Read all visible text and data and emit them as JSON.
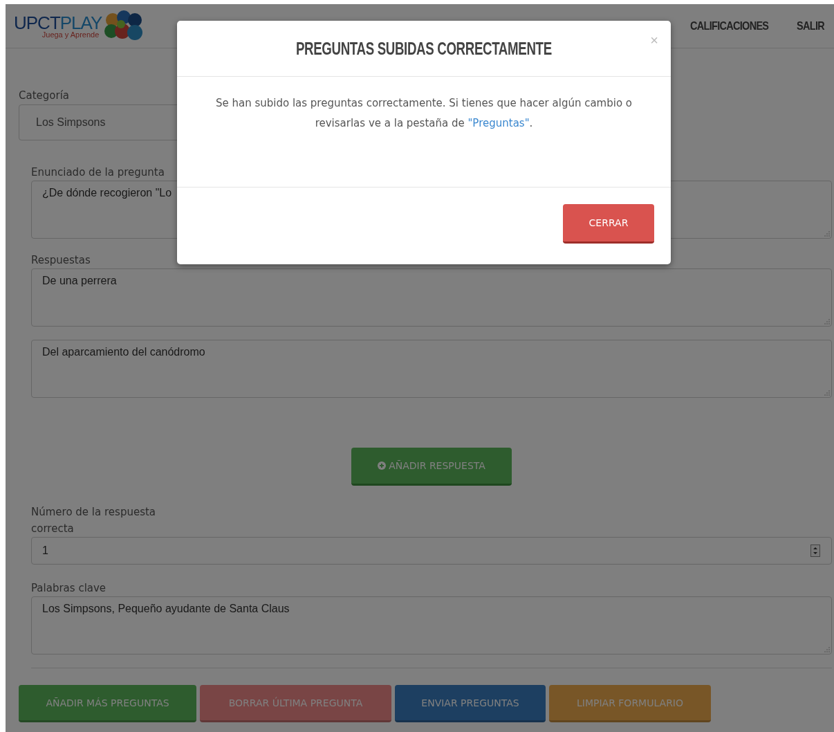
{
  "header": {
    "logo": {
      "title_a": "UPCT",
      "title_b": "PLAY",
      "tagline": "Juega y Aprende"
    },
    "nav": [
      {
        "label": "CALIFICACIONES"
      },
      {
        "label": "SALIR"
      }
    ]
  },
  "form": {
    "category": {
      "label": "Categoría",
      "value": "Los Simpsons"
    },
    "question": {
      "label": "Enunciado de la pregunta",
      "value": "¿De dónde recogieron \"Lo"
    },
    "answers_label": "Respuestas",
    "answers": [
      {
        "value": "De una perrera"
      },
      {
        "value": "Del aparcamiento del canódromo"
      }
    ],
    "add_answer": "AÑADIR RESPUESTA",
    "correct": {
      "label": "Número de la respuesta correcta",
      "value": "1"
    },
    "keywords": {
      "label": "Palabras clave",
      "value": "Los Simpsons, Pequeño ayudante de Santa Claus"
    },
    "actions": [
      {
        "label": "AÑADIR MÁS PREGUNTAS",
        "kind": "success"
      },
      {
        "label": "BORRAR ÚLTIMA PREGUNTA",
        "kind": "danger"
      },
      {
        "label": "ENVIAR PREGUNTAS",
        "kind": "primary"
      },
      {
        "label": "LIMPIAR FORMULARIO",
        "kind": "warning"
      }
    ]
  },
  "modal": {
    "title": "PREGUNTAS SUBIDAS CORRECTAMENTE",
    "close": "×",
    "message": {
      "before": "Se han subido las preguntas correctamente. Si tienes que hacer algún cambio o revisarlas ve a la pestaña de ",
      "link": "\"Preguntas\"",
      "after": "."
    },
    "button": "CERRAR"
  }
}
